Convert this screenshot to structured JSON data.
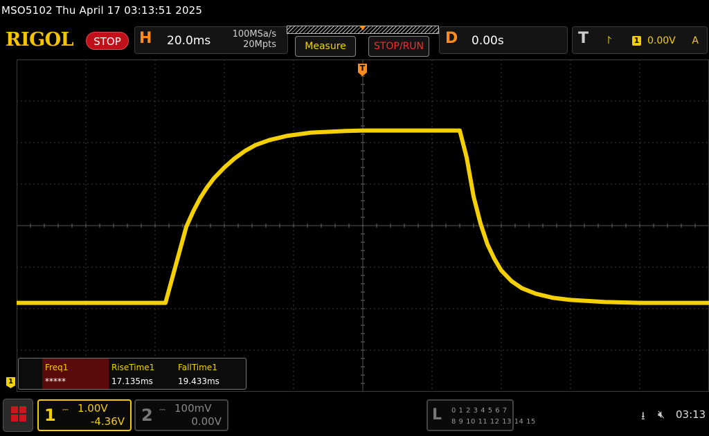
{
  "title_bar": {
    "text": "MSO5102  Thu April 17 03:13:51 2025"
  },
  "brand": {
    "logo": "RIGOL",
    "run_state": "STOP"
  },
  "horizontal": {
    "letter": "H",
    "timebase": "20.0ms",
    "sample_rate": "100MSa/s",
    "memory_depth": "20Mpts"
  },
  "buttons": {
    "measure": "Measure",
    "stop_run": "STOP/RUN"
  },
  "delay": {
    "letter": "D",
    "value": "0.00s"
  },
  "trigger": {
    "letter": "T",
    "edge_icon": "rising-edge-icon",
    "edge_glyph": "⨡",
    "source": "1",
    "level": "0.00V",
    "mode": "A",
    "position_marker": "T"
  },
  "measurements": [
    {
      "name": "Freq1",
      "value": "*****",
      "highlighted": true
    },
    {
      "name": "RiseTime1",
      "value": "17.135ms",
      "highlighted": false
    },
    {
      "name": "FallTime1",
      "value": "19.433ms",
      "highlighted": false
    }
  ],
  "channel1": {
    "number": "1",
    "coupling": "DC",
    "scale": "1.00V",
    "offset": "-4.36V",
    "marker": "1",
    "color": "#f4d000"
  },
  "channel2": {
    "number": "2",
    "coupling": "DC",
    "scale": "100mV",
    "offset": "0.00V",
    "color": "#777777"
  },
  "logic": {
    "letter": "L",
    "row1": "0 1 2 3   4 5 6 7",
    "row2": "8  9 10 11 12 13 14 15"
  },
  "status": {
    "usb_icon": "usb-icon",
    "speaker_icon": "speaker-muted-icon",
    "time": "03:13"
  },
  "chart_data": {
    "type": "line",
    "title": "",
    "xlabel": "",
    "ylabel": "",
    "x_unit": "ms",
    "y_unit": "V",
    "x_per_div": 20,
    "y_per_div": 1.0,
    "xlim": [
      -100,
      100
    ],
    "ylim": [
      -4,
      4
    ],
    "grid": true,
    "series": [
      {
        "color": "#f4d000",
        "x": [
          -100,
          -57,
          -53,
          -51,
          -49,
          -47,
          -45,
          -43,
          -40,
          -37,
          -34,
          -31,
          -27,
          -22,
          -15,
          -5,
          0,
          10,
          20,
          28,
          30,
          32,
          34,
          36,
          38,
          40,
          43,
          46,
          50,
          55,
          60,
          70,
          80,
          100
        ],
        "y": [
          -1.86,
          -1.86,
          -0.64,
          -0.03,
          0.34,
          0.66,
          0.92,
          1.14,
          1.4,
          1.62,
          1.8,
          1.94,
          2.06,
          2.16,
          2.24,
          2.28,
          2.29,
          2.29,
          2.29,
          2.29,
          1.64,
          0.7,
          0.05,
          -0.45,
          -0.8,
          -1.08,
          -1.34,
          -1.51,
          -1.64,
          -1.74,
          -1.79,
          -1.84,
          -1.86,
          -1.86
        ]
      }
    ]
  }
}
